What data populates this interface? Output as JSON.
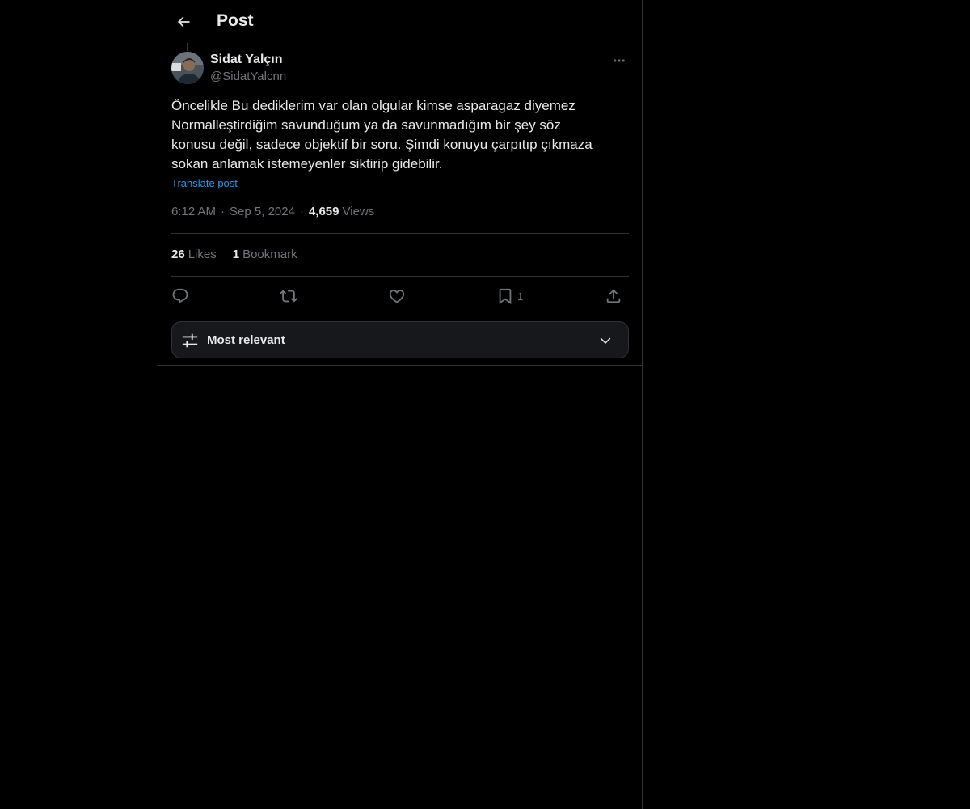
{
  "header": {
    "title": "Post",
    "back_icon": "arrow-left-icon"
  },
  "author": {
    "name": "Sidat Yalçın",
    "handle": "@SidatYalcnn",
    "more_icon": "more-horizontal-icon"
  },
  "post": {
    "text": "Öncelikle Bu dediklerim var olan olgular kimse asparagaz diyemez\nNormalleştirdiğim savunduğum ya da savunmadığım bir şey söz\nkonusu değil, sadece objektif bir soru. Şimdi konuyu çarpıtıp çıkmaza\nsokan anlamak istemeyenler siktirip gidebilir.",
    "translate_label": "Translate post",
    "time": "6:12 AM",
    "separator": "·",
    "date": "Sep 5, 2024",
    "views_count": "4,659",
    "views_label": "Views"
  },
  "stats": {
    "likes_count": "26",
    "likes_label": "Likes",
    "bookmarks_count": "1",
    "bookmarks_label": "Bookmark"
  },
  "actions": {
    "reply_icon": "reply-icon",
    "repost_icon": "repost-icon",
    "like_icon": "heart-icon",
    "bookmark_icon": "bookmark-icon",
    "bookmark_count": "1",
    "share_icon": "share-icon"
  },
  "sort": {
    "label": "Most relevant",
    "icon": "sliders-icon",
    "chevron": "chevron-down-icon"
  },
  "colors": {
    "background": "#000000",
    "text_primary": "#e7e9ea",
    "text_secondary": "#71767b",
    "accent": "#1d9bf0",
    "border": "#2f3336"
  }
}
